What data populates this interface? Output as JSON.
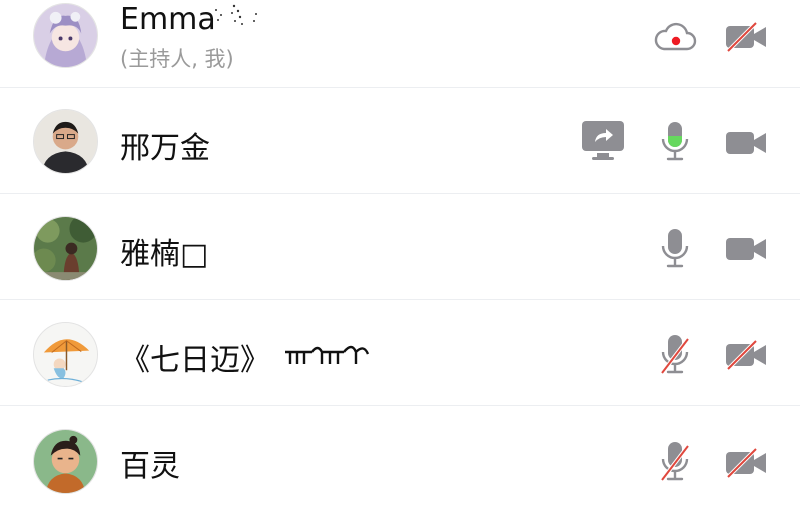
{
  "participants": [
    {
      "name": "Emma",
      "role_label": "(主持人, 我)",
      "icons": [
        "cloud-record-icon",
        "video-off-icon"
      ],
      "colors": {
        "record_dot": "#ee1b24"
      }
    },
    {
      "name": "邢万金",
      "icons": [
        "screen-share-icon",
        "mic-active-icon",
        "video-icon"
      ],
      "colors": {
        "mic_level": "#66d85e"
      }
    },
    {
      "name": "雅楠□",
      "icons": [
        "mic-icon",
        "video-icon"
      ]
    },
    {
      "name": "《七日迈》",
      "icons": [
        "mic-off-icon",
        "video-off-icon"
      ]
    },
    {
      "name": "百灵",
      "icons": [
        "mic-off-icon",
        "video-off-icon"
      ]
    }
  ],
  "colors": {
    "icon_gray": "#8e8e93",
    "slash_red": "#e0483e",
    "divider": "#eceef1"
  }
}
